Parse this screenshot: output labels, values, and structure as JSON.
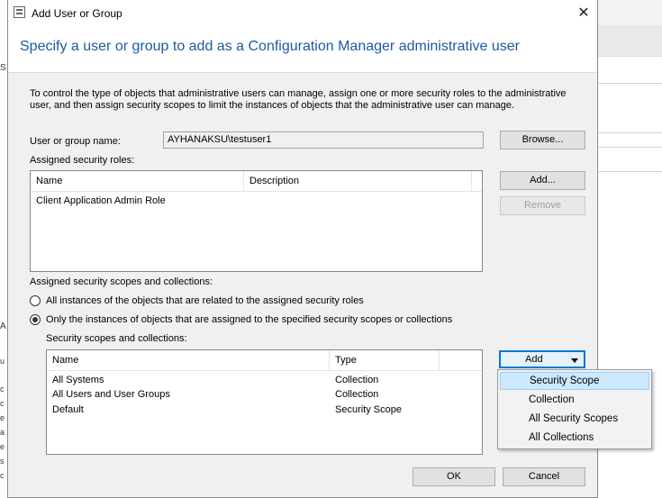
{
  "window": {
    "title": "Add User or Group"
  },
  "header": {
    "title": "Specify a user or group to add as a Configuration Manager administrative user"
  },
  "intro": "To control the type of objects that administrative users can manage, assign one or more security roles  to the  administrative user, and then assign security scopes to limit the instances of objects that the administrative user can manage.",
  "user_field": {
    "label": "User or group name:",
    "value": "AYHANAKSU\\testuser1",
    "browse_label": "Browse..."
  },
  "roles": {
    "label": "Assigned security roles:",
    "columns": [
      "Name",
      "Description"
    ],
    "rows": [
      {
        "name": "Client Application Admin Role",
        "description": ""
      }
    ],
    "add_label": "Add...",
    "remove_label": "Remove"
  },
  "scopes": {
    "label": "Assigned security scopes and collections:",
    "radio_all": "All instances of the objects that are related to the assigned security roles",
    "radio_only": "Only the instances of objects that are assigned to the specified security scopes or collections",
    "list_label": "Security scopes and collections:",
    "columns": [
      "Name",
      "Type"
    ],
    "rows": [
      {
        "name": "All Systems",
        "type": "Collection"
      },
      {
        "name": "All Users and User Groups",
        "type": "Collection"
      },
      {
        "name": "Default",
        "type": "Security Scope"
      }
    ],
    "add_label": "Add"
  },
  "add_menu": {
    "items": [
      "Security Scope",
      "Collection",
      "All Security Scopes",
      "All Collections"
    ]
  },
  "footer": {
    "ok_label": "OK",
    "cancel_label": "Cancel"
  },
  "background": {
    "left_letters": [
      "S",
      "A"
    ],
    "left_fragments": [
      "u",
      "c",
      "c",
      "e",
      "a",
      "e",
      "s",
      "c"
    ]
  }
}
